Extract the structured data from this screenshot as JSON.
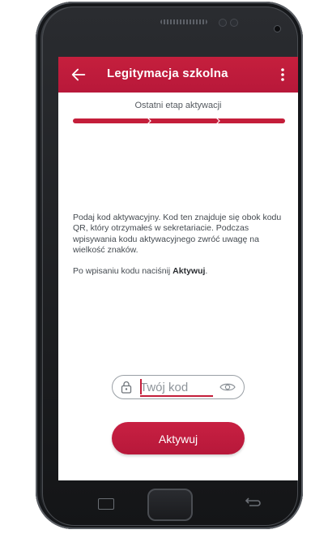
{
  "app_bar": {
    "title": "Legitymacja szkolna",
    "back_icon": "arrow-left-icon",
    "menu_icon": "more-vertical-icon",
    "color": "#c41e3a"
  },
  "activation": {
    "step_label": "Ostatni etap aktywacji",
    "steps_total": 3,
    "steps_completed": 3,
    "progress_color": "#c41e3a",
    "instructions": [
      "Podaj kod aktywacyjny. Kod ten znajduje się obok kodu QR, który otrzymałeś w sekretariacie. Podczas wpisywania kodu aktywacyjnego zwróć uwagę na wielkość znaków."
    ],
    "hint_prefix": "Po wpisaniu kodu naciśnij ",
    "hint_bold": "Aktywuj",
    "hint_suffix": ".",
    "code_input": {
      "placeholder": "Twój kod",
      "value": "",
      "left_icon": "lock-icon",
      "right_icon": "eye-icon"
    },
    "button_label": "Aktywuj"
  },
  "device_nav": {
    "recents_icon": "recents-square-icon",
    "back_icon": "back-arrow-icon"
  }
}
